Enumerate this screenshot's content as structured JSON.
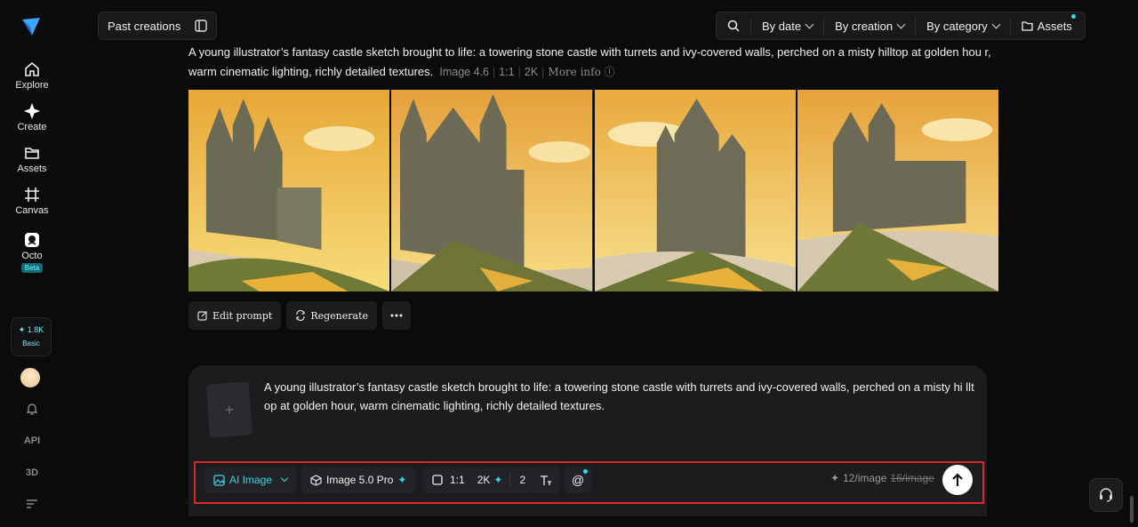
{
  "sidebar": {
    "items": [
      {
        "label": "Explore",
        "icon": "home-icon"
      },
      {
        "label": "Create",
        "icon": "sparkle-icon"
      },
      {
        "label": "Assets",
        "icon": "folder-icon"
      },
      {
        "label": "Canvas",
        "icon": "canvas-icon"
      },
      {
        "label": "Octo",
        "icon": "octo-icon",
        "badge": "Beta"
      }
    ],
    "credits": {
      "amount": "1.8K",
      "plan": "Basic"
    },
    "bottom": {
      "api": "API",
      "threeD": "3D"
    }
  },
  "topbar": {
    "past_creations": "Past creations",
    "filters": {
      "by_date": "By date",
      "by_creation": "By creation",
      "by_category": "By category",
      "assets": "Assets"
    }
  },
  "generation": {
    "prompt": "A young illustrator’s fantasy castle sketch brought to life: a towering stone castle with turrets and ivy-covered walls, perched on a misty hilltop at golden hou r, warm cinematic lighting, richly detailed textures.",
    "model": "Image 4.6",
    "ratio": "1:1",
    "resolution": "2K",
    "more_info": "More info",
    "actions": {
      "edit": "Edit prompt",
      "regenerate": "Regenerate"
    }
  },
  "composer": {
    "text": "A young illustrator’s fantasy castle sketch brought to life: a towering stone castle with turrets and ivy-covered walls, perched on a misty hi lltop at golden hour, warm cinematic lighting, richly detailed textures.",
    "mode": "AI Image",
    "model": "Image 5.0 Pro",
    "ratio": "1:1",
    "resolution": "2K",
    "count": "2",
    "cost": "12/image",
    "old_cost": "16/image"
  },
  "colors": {
    "accent": "#38d6e6",
    "highlight_border": "#d8262c"
  }
}
